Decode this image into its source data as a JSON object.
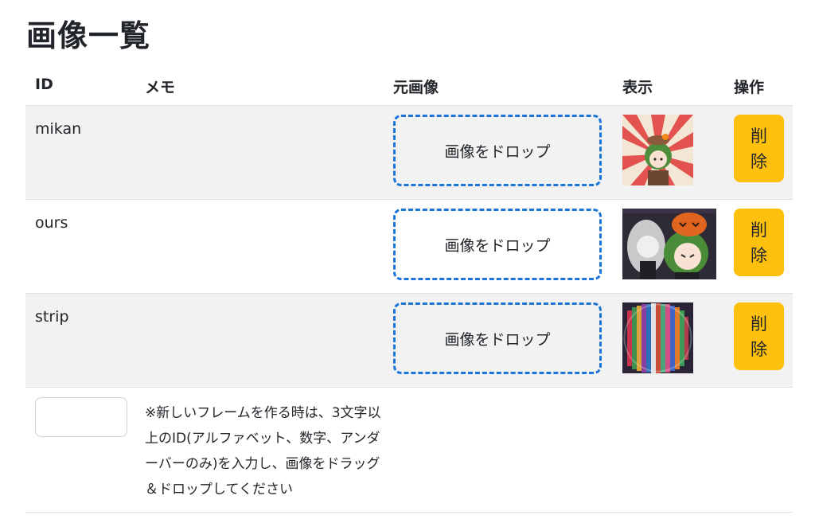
{
  "page": {
    "title": "画像一覧"
  },
  "table": {
    "headers": {
      "id": "ID",
      "memo": "メモ",
      "original": "元画像",
      "display": "表示",
      "actions": "操作"
    },
    "rows": [
      {
        "id": "mikan",
        "memo": "",
        "drop_label": "画像をドロップ",
        "delete_label": "削除",
        "thumbnail": "mikan-thumbnail"
      },
      {
        "id": "ours",
        "memo": "",
        "drop_label": "画像をドロップ",
        "delete_label": "削除",
        "thumbnail": "ours-thumbnail"
      },
      {
        "id": "strip",
        "memo": "",
        "drop_label": "画像をドロップ",
        "delete_label": "削除",
        "thumbnail": "strip-thumbnail"
      }
    ]
  },
  "new_frame": {
    "id_value": "",
    "id_placeholder": "",
    "note": "※新しいフレームを作る時は、3文字以上のID(アルファベット、数字、アンダーバーのみ)を入力し、画像をドラッグ＆ドロップしてください"
  },
  "colors": {
    "delete_button": "#fdc00f",
    "drop_border": "#1c74d8",
    "stripe": "#f2f2f2"
  }
}
